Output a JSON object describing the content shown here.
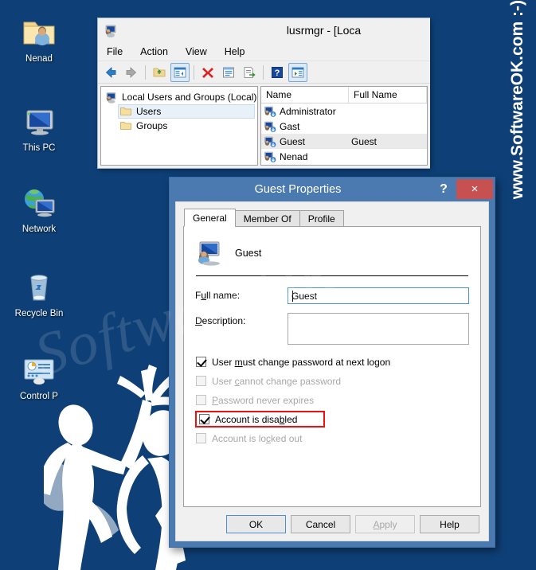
{
  "desktop": {
    "background_color": "#0e4077",
    "icons": [
      {
        "label": "Nenad",
        "icon": "user-folder-icon"
      },
      {
        "label": "This PC",
        "icon": "computer-icon"
      },
      {
        "label": "Network",
        "icon": "network-icon"
      },
      {
        "label": "Recycle Bin",
        "icon": "recycle-bin-icon"
      },
      {
        "label": "Control P",
        "icon": "control-panel-icon"
      }
    ],
    "watermark_vertical": "www.SoftwareOK.com  :-)",
    "watermark_ghost": "SoftwareOK"
  },
  "lusrmgr": {
    "title": "lusrmgr - [Loca",
    "app_icon": "users-and-groups-icon",
    "menus": [
      "File",
      "Action",
      "View",
      "Help"
    ],
    "toolbar": [
      {
        "name": "back-button",
        "icon": "back-arrow-icon",
        "pressed": false
      },
      {
        "name": "forward-button",
        "icon": "forward-arrow-icon",
        "pressed": false
      },
      {
        "name": "up-one-level-button",
        "icon": "folder-up-icon",
        "pressed": false
      },
      {
        "name": "show-hide-tree-button",
        "icon": "tree-pane-icon",
        "pressed": true
      },
      {
        "name": "delete-button",
        "icon": "red-x-icon",
        "pressed": false
      },
      {
        "name": "properties-button",
        "icon": "properties-icon",
        "pressed": false
      },
      {
        "name": "export-list-button",
        "icon": "export-list-icon",
        "pressed": false
      },
      {
        "name": "help-button",
        "icon": "question-mark-icon",
        "pressed": false
      },
      {
        "name": "show-action-pane-button",
        "icon": "action-pane-icon",
        "pressed": true
      }
    ],
    "tree": {
      "root": "Local Users and Groups (Local)",
      "children": [
        {
          "label": "Users",
          "selected": true
        },
        {
          "label": "Groups",
          "selected": false
        }
      ]
    },
    "list": {
      "columns": [
        "Name",
        "Full Name"
      ],
      "rows": [
        {
          "name": "Administrator",
          "full_name": "",
          "selected": false
        },
        {
          "name": "Gast",
          "full_name": "",
          "selected": false
        },
        {
          "name": "Guest",
          "full_name": "Guest",
          "selected": true
        },
        {
          "name": "Nenad",
          "full_name": "",
          "selected": false
        }
      ]
    }
  },
  "dialog": {
    "title": "Guest Properties",
    "titlebar_color": "#4a7ab0",
    "close_color": "#c75050",
    "help_glyph": "?",
    "close_glyph": "×",
    "tabs": [
      {
        "label": "General",
        "active": true
      },
      {
        "label": "Member Of",
        "active": false
      },
      {
        "label": "Profile",
        "active": false
      }
    ],
    "user_name": "Guest",
    "user_icon": "user-account-icon",
    "fields": [
      {
        "label_pre": "F",
        "label_mnemonic": "u",
        "label_post": "ll name:",
        "value": "Guest",
        "placeholder": "",
        "focused": true,
        "tall": false
      },
      {
        "label_pre": "",
        "label_mnemonic": "D",
        "label_post": "escription:",
        "value": "",
        "placeholder": "",
        "focused": false,
        "tall": true
      }
    ],
    "checkboxes": [
      {
        "pre": "User ",
        "mnemonic": "m",
        "post": "ust change password at next logon",
        "checked": true,
        "disabled": false,
        "annotated": false
      },
      {
        "pre": "User ",
        "mnemonic": "c",
        "post": "annot change password",
        "checked": false,
        "disabled": true,
        "annotated": false
      },
      {
        "pre": "",
        "mnemonic": "P",
        "post": "assword never expires",
        "checked": false,
        "disabled": true,
        "annotated": false
      },
      {
        "pre": "Account is disa",
        "mnemonic": "b",
        "post": "led",
        "checked": true,
        "disabled": false,
        "annotated": true
      },
      {
        "pre": "Account is lo",
        "mnemonic": "c",
        "post": "ked out",
        "checked": false,
        "disabled": true,
        "annotated": false
      }
    ],
    "annotation_color": "#ee1111",
    "buttons": [
      {
        "pre": "OK",
        "mnemonic": "",
        "post": "",
        "state": "default"
      },
      {
        "pre": "Cancel",
        "mnemonic": "",
        "post": "",
        "state": "normal"
      },
      {
        "pre": "",
        "mnemonic": "A",
        "post": "pply",
        "state": "disabled"
      },
      {
        "pre": "Help",
        "mnemonic": "",
        "post": "",
        "state": "normal"
      }
    ]
  }
}
